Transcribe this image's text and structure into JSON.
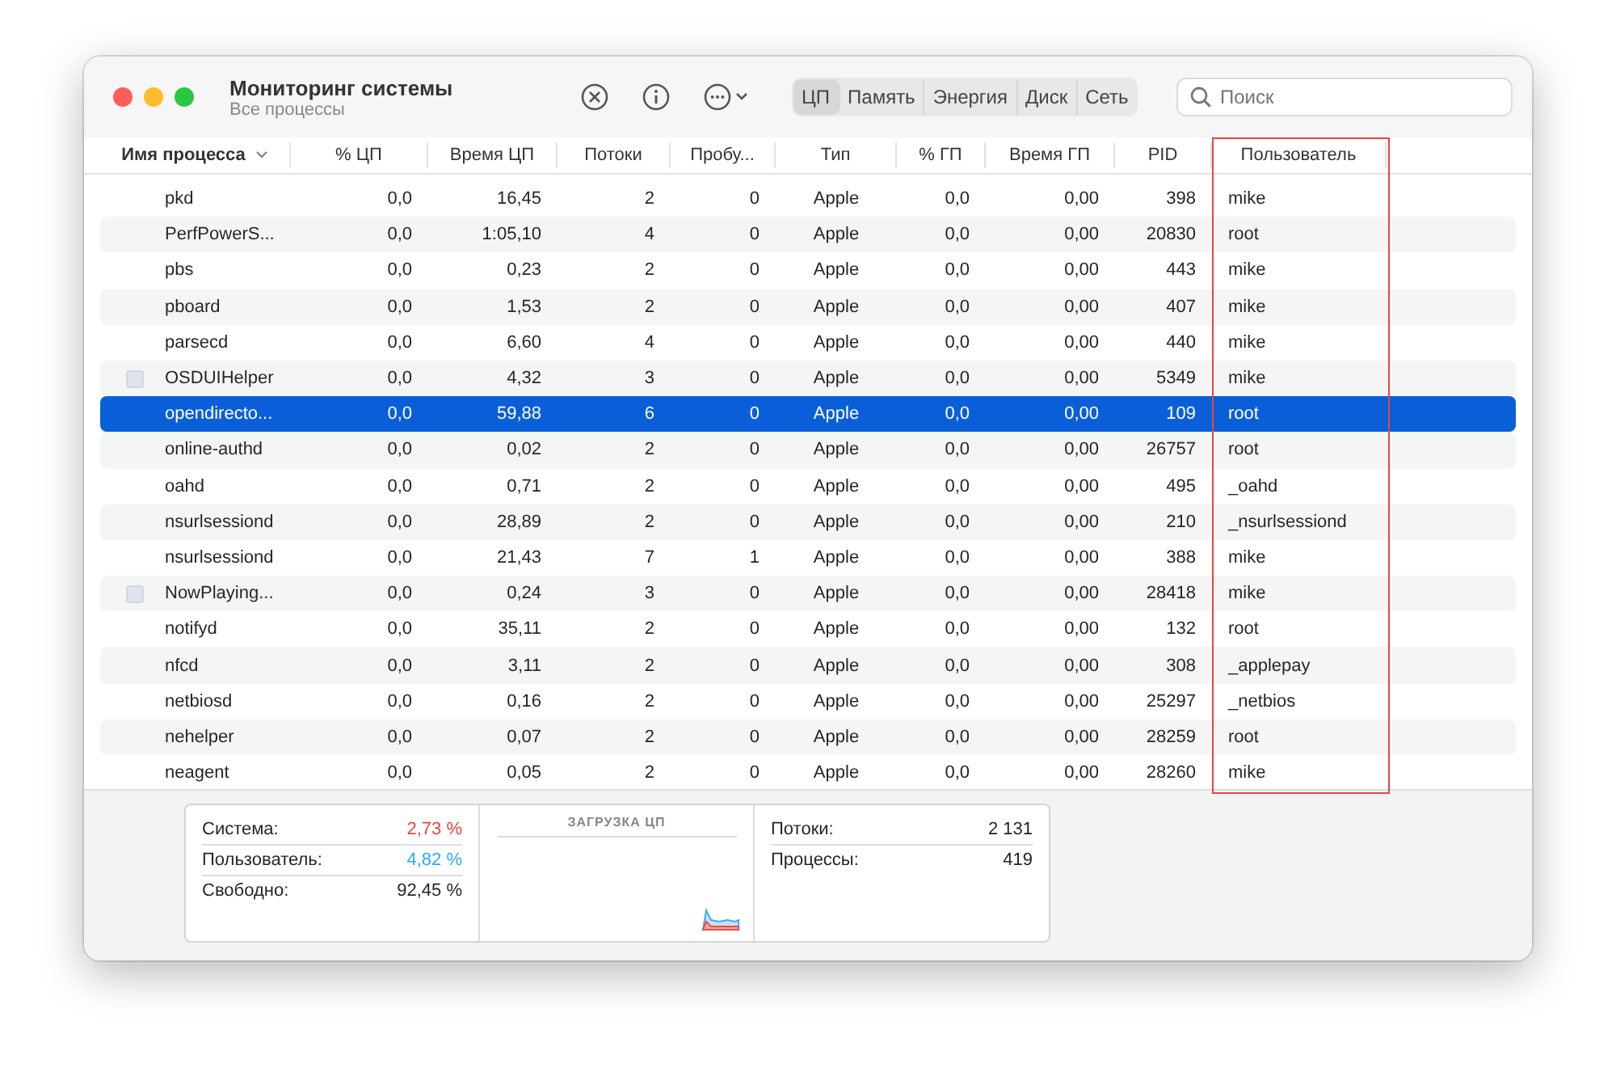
{
  "window": {
    "title": "Мониторинг системы",
    "subtitle": "Все процессы"
  },
  "tabs": [
    {
      "label": "ЦП",
      "selected": true
    },
    {
      "label": "Память",
      "selected": false
    },
    {
      "label": "Энергия",
      "selected": false
    },
    {
      "label": "Диск",
      "selected": false
    },
    {
      "label": "Сеть",
      "selected": false
    }
  ],
  "search": {
    "placeholder": "Поиск"
  },
  "table": {
    "columns": [
      {
        "label": "Имя процесса",
        "sorted": true,
        "highlighted": false
      },
      {
        "label": "% ЦП",
        "sorted": false,
        "highlighted": false
      },
      {
        "label": "Время ЦП",
        "sorted": false,
        "highlighted": false
      },
      {
        "label": "Потоки",
        "sorted": false,
        "highlighted": false
      },
      {
        "label": "Пробу...",
        "sorted": false,
        "highlighted": false
      },
      {
        "label": "Тип",
        "sorted": false,
        "highlighted": false
      },
      {
        "label": "% ГП",
        "sorted": false,
        "highlighted": false
      },
      {
        "label": "Время ГП",
        "sorted": false,
        "highlighted": false
      },
      {
        "label": "PID",
        "sorted": false,
        "highlighted": false
      },
      {
        "label": "Пользователь",
        "sorted": false,
        "highlighted": true
      }
    ],
    "rows": [
      {
        "cells": [
          "pkd",
          "0,0",
          "16,45",
          "2",
          "0",
          "Apple",
          "0,0",
          "0,00",
          "398",
          "mike"
        ],
        "app_icon": false,
        "selected": false
      },
      {
        "cells": [
          "PerfPowerS...",
          "0,0",
          "1:05,10",
          "4",
          "0",
          "Apple",
          "0,0",
          "0,00",
          "20830",
          "root"
        ],
        "app_icon": false,
        "selected": false
      },
      {
        "cells": [
          "pbs",
          "0,0",
          "0,23",
          "2",
          "0",
          "Apple",
          "0,0",
          "0,00",
          "443",
          "mike"
        ],
        "app_icon": false,
        "selected": false
      },
      {
        "cells": [
          "pboard",
          "0,0",
          "1,53",
          "2",
          "0",
          "Apple",
          "0,0",
          "0,00",
          "407",
          "mike"
        ],
        "app_icon": false,
        "selected": false
      },
      {
        "cells": [
          "parsecd",
          "0,0",
          "6,60",
          "4",
          "0",
          "Apple",
          "0,0",
          "0,00",
          "440",
          "mike"
        ],
        "app_icon": false,
        "selected": false
      },
      {
        "cells": [
          "OSDUIHelper",
          "0,0",
          "4,32",
          "3",
          "0",
          "Apple",
          "0,0",
          "0,00",
          "5349",
          "mike"
        ],
        "app_icon": true,
        "selected": false
      },
      {
        "cells": [
          "opendirecto...",
          "0,0",
          "59,88",
          "6",
          "0",
          "Apple",
          "0,0",
          "0,00",
          "109",
          "root"
        ],
        "app_icon": false,
        "selected": true
      },
      {
        "cells": [
          "online-authd",
          "0,0",
          "0,02",
          "2",
          "0",
          "Apple",
          "0,0",
          "0,00",
          "26757",
          "root"
        ],
        "app_icon": false,
        "selected": false
      },
      {
        "cells": [
          "oahd",
          "0,0",
          "0,71",
          "2",
          "0",
          "Apple",
          "0,0",
          "0,00",
          "495",
          "_oahd"
        ],
        "app_icon": false,
        "selected": false
      },
      {
        "cells": [
          "nsurlsessiond",
          "0,0",
          "28,89",
          "2",
          "0",
          "Apple",
          "0,0",
          "0,00",
          "210",
          "_nsurlsessiond"
        ],
        "app_icon": false,
        "selected": false
      },
      {
        "cells": [
          "nsurlsessiond",
          "0,0",
          "21,43",
          "7",
          "1",
          "Apple",
          "0,0",
          "0,00",
          "388",
          "mike"
        ],
        "app_icon": false,
        "selected": false
      },
      {
        "cells": [
          "NowPlaying...",
          "0,0",
          "0,24",
          "3",
          "0",
          "Apple",
          "0,0",
          "0,00",
          "28418",
          "mike"
        ],
        "app_icon": true,
        "selected": false
      },
      {
        "cells": [
          "notifyd",
          "0,0",
          "35,11",
          "2",
          "0",
          "Apple",
          "0,0",
          "0,00",
          "132",
          "root"
        ],
        "app_icon": false,
        "selected": false
      },
      {
        "cells": [
          "nfcd",
          "0,0",
          "3,11",
          "2",
          "0",
          "Apple",
          "0,0",
          "0,00",
          "308",
          "_applepay"
        ],
        "app_icon": false,
        "selected": false
      },
      {
        "cells": [
          "netbiosd",
          "0,0",
          "0,16",
          "2",
          "0",
          "Apple",
          "0,0",
          "0,00",
          "25297",
          "_netbios"
        ],
        "app_icon": false,
        "selected": false
      },
      {
        "cells": [
          "nehelper",
          "0,0",
          "0,07",
          "2",
          "0",
          "Apple",
          "0,0",
          "0,00",
          "28259",
          "root"
        ],
        "app_icon": false,
        "selected": false
      },
      {
        "cells": [
          "neagent",
          "0,0",
          "0,05",
          "2",
          "0",
          "Apple",
          "0,0",
          "0,00",
          "28260",
          "mike"
        ],
        "app_icon": false,
        "selected": false
      }
    ]
  },
  "summary": {
    "left": [
      {
        "label": "Система:",
        "value": "2,73 %",
        "color": "#f0413a"
      },
      {
        "label": "Пользователь:",
        "value": "4,82 %",
        "color": "#2fa8f0"
      },
      {
        "label": "Свободно:",
        "value": "92,45 %",
        "color": "#262626"
      }
    ],
    "chart_title": "ЗАГРУЗКА ЦП",
    "right": [
      {
        "label": "Потоки:",
        "value": "2 131"
      },
      {
        "label": "Процессы:",
        "value": "419"
      }
    ]
  }
}
